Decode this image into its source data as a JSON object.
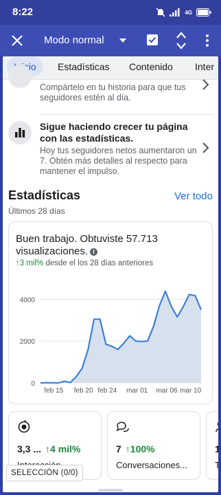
{
  "status_bar": {
    "time": "8:22",
    "network": "4G"
  },
  "toolbar": {
    "mode_label": "Modo normal"
  },
  "tabs": [
    {
      "label": "Inicio",
      "active": true
    },
    {
      "label": "Estadísticas",
      "active": false
    },
    {
      "label": "Contenido",
      "active": false
    },
    {
      "label": "Inter",
      "active": false
    }
  ],
  "suggestions": [
    {
      "title": "",
      "description": "Compártelo en tu historia para que tus seguidores estén al día."
    },
    {
      "title": "Sigue haciendo crecer tu página con las estadísticas.",
      "description": "Hoy tus seguidores netos aumentaron un 7. Obtén más detalles al respecto para mantener el impulso."
    }
  ],
  "insights": {
    "title": "Estadísticas",
    "see_all": "Ver todo",
    "period": "Últimos 28 días",
    "headline": "Buen trabajo. Obtuviste 57.713 visualizaciones.",
    "delta_value": "3 mil%",
    "delta_text": "desde el los 28 días anteriores"
  },
  "chart_data": {
    "type": "area",
    "x_ticks": [
      "feb 15",
      "feb 20",
      "feb 24",
      "mar 01",
      "mar 06",
      "mar 10"
    ],
    "y_ticks": [
      "0",
      "2000",
      "4000"
    ],
    "ylim": [
      0,
      4600
    ],
    "x": [
      0,
      1,
      2,
      3,
      4,
      5,
      6,
      7,
      8,
      9,
      10,
      11,
      12,
      13,
      14,
      15,
      16,
      17,
      18,
      19,
      20,
      21,
      22,
      23,
      24,
      25,
      26,
      27
    ],
    "values": [
      0,
      10,
      5,
      0,
      80,
      20,
      300,
      700,
      1600,
      3050,
      3050,
      1850,
      1750,
      1600,
      1900,
      2250,
      2000,
      1980,
      2000,
      2700,
      3700,
      4380,
      3650,
      3150,
      3650,
      4230,
      4170,
      3500
    ],
    "color": "#3b7fd9",
    "fill": "#d7e1ee",
    "grid": true
  },
  "mini_cards": [
    {
      "value": "3,3 ...",
      "delta": "4 mil%",
      "label": "Interacción"
    },
    {
      "value": "7",
      "delta": "100%",
      "label": "Conversaciones..."
    },
    {
      "value": "1",
      "delta": "",
      "label": "T"
    }
  ],
  "selection": {
    "label": "SELECCIÓN (0/0)"
  }
}
